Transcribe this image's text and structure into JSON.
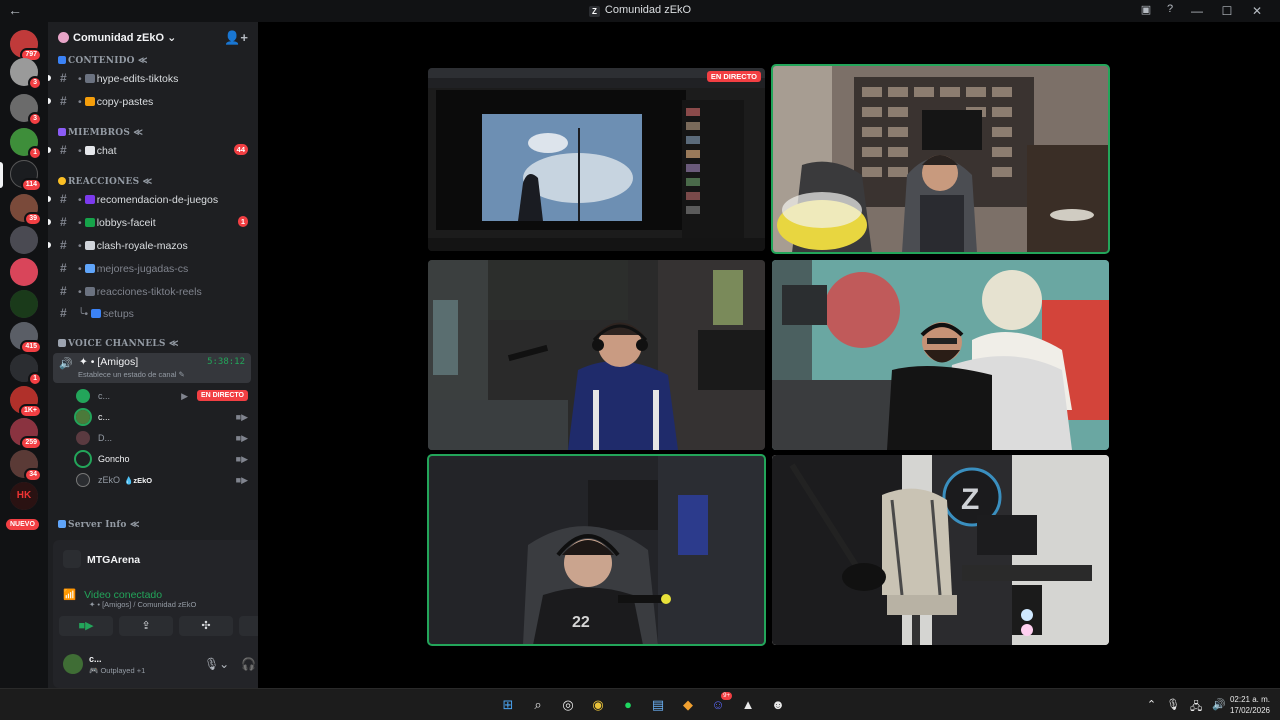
{
  "window": {
    "title": "Comunidad zEkO",
    "back_glyph": "←"
  },
  "server_rail": {
    "badges": [
      "797",
      "3",
      "3",
      "1",
      "114",
      "39",
      "415",
      "1",
      "1K+",
      "259",
      "34"
    ],
    "nuevo_label": "NUEVO"
  },
  "guild": {
    "name": "Comunidad zEkO",
    "categories": {
      "contenido": "CONTENIDO ≪",
      "miembros": "MIEMBROS ≪",
      "reacciones": "REACCIONES ≪",
      "voice": "VOICE CHANNELS ≪",
      "server_info": "Server Info ≪"
    },
    "channels": [
      {
        "name": "hype-edits-tiktoks",
        "count": ""
      },
      {
        "name": "copy-pastes",
        "count": ""
      },
      {
        "name": "chat",
        "count": "44"
      },
      {
        "name": "recomendacion-de-juegos",
        "count": ""
      },
      {
        "name": "lobbys-faceit",
        "count": "1"
      },
      {
        "name": "clash-royale-mazos",
        "count": ""
      },
      {
        "name": "mejores-jugadas-cs",
        "count": ""
      },
      {
        "name": "reacciones-tiktok-reels",
        "count": ""
      },
      {
        "name": "setups",
        "count": ""
      }
    ],
    "voice_channel": {
      "name": "[Amigos]",
      "timer": "5:38:12",
      "status": "Establece un estado de canal"
    },
    "voice_users": [
      {
        "name": "c...",
        "live": "EN DIRECTO"
      },
      {
        "name": "c..."
      },
      {
        "name": "D..."
      },
      {
        "name": "Goncho"
      },
      {
        "name": "zEkO",
        "tag": "zEkO"
      }
    ]
  },
  "panel": {
    "activity": "MTGArena",
    "connection": "Video conectado",
    "connection_sub": "[Amigos] / Comunidad zEkO",
    "user_name": "c...",
    "user_status": "Outplayed +1"
  },
  "stream": {
    "live_label": "EN DIRECTO"
  },
  "taskbar": {
    "discord_badge": "9+",
    "time": "02:21 a. m.",
    "date": "17/02/2026"
  },
  "colors": {
    "accent_green": "#23a55a",
    "live_red": "#f23f43",
    "sidebar_bg": "#1e1f22"
  }
}
